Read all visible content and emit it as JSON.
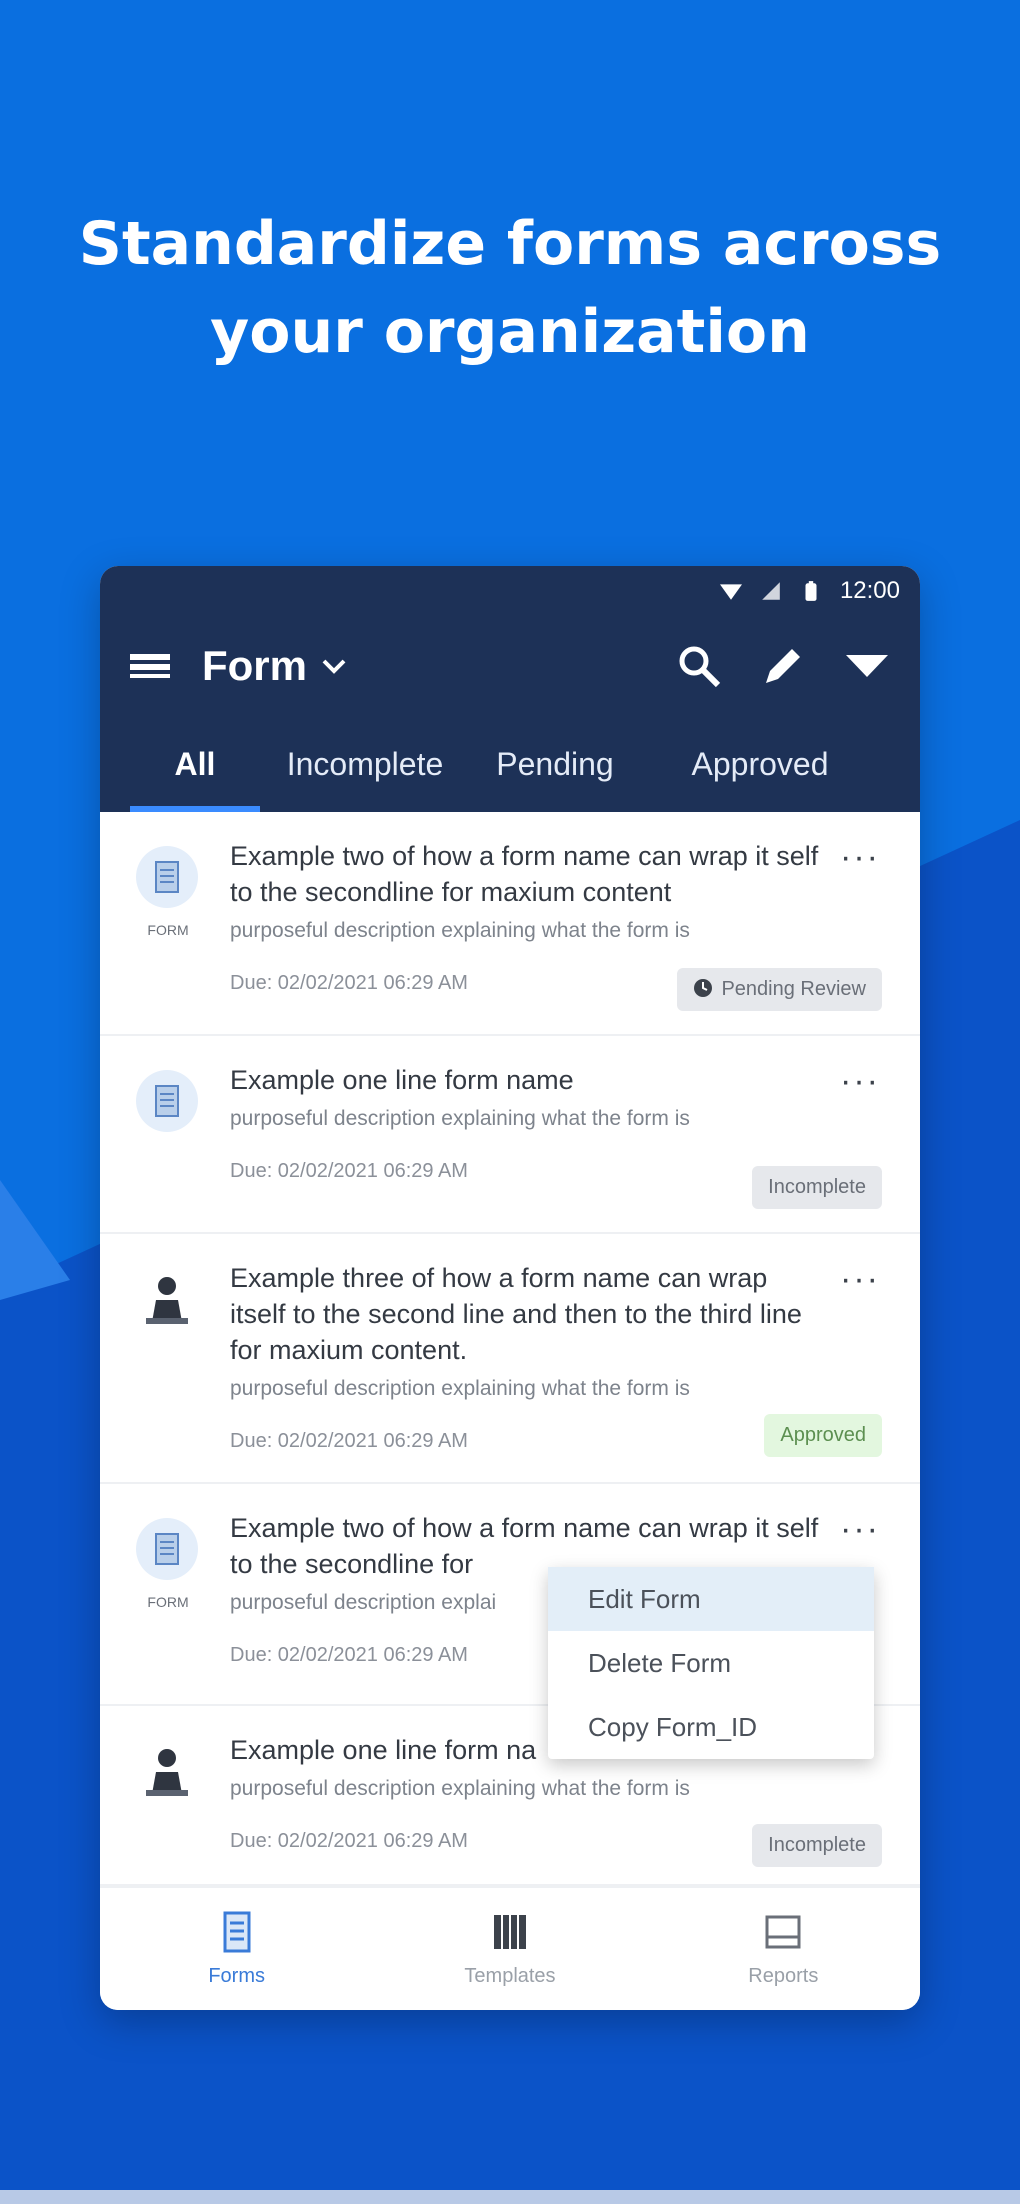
{
  "headline": {
    "line1": "Standardize forms across",
    "line2": "your organization"
  },
  "colors": {
    "background": "#0a6fe0",
    "appbar": "#1d3157",
    "accent": "#3a8bff"
  },
  "statusbar": {
    "time": "12:00"
  },
  "toolbar": {
    "title": "Form",
    "icons": [
      "menu-icon",
      "chevron-down-icon",
      "search-icon",
      "pencil-icon",
      "filter-icon"
    ]
  },
  "tabs": [
    {
      "label": "All",
      "active": true
    },
    {
      "label": "Incomplete",
      "active": false
    },
    {
      "label": "Pending",
      "active": false
    },
    {
      "label": "Approved",
      "active": false
    }
  ],
  "items": [
    {
      "name": "Example two of how a form name can wrap it self to the secondline for maxium content",
      "description": "purposeful description explaining what the form is",
      "due": "Due: 02/02/2021 06:29 AM",
      "badge": "Pending Review",
      "avatar_caption": "FORM"
    },
    {
      "name": "Example one line form name",
      "description": "purposeful description explaining what the form is",
      "due": "Due: 02/02/2021 06:29 AM",
      "badge": "Incomplete"
    },
    {
      "name": "Example three of how a form name can wrap itself to the second line and then to the third line for maxium content.",
      "description": "purposeful description explaining what the form is",
      "due": "Due: 02/02/2021 06:29 AM",
      "badge": "Approved"
    },
    {
      "name": "Example two of how a form name can wrap it self to the secondline for",
      "description": "purposeful description explai",
      "due": "Due: 02/02/2021 06:29 AM",
      "avatar_caption": "FORM"
    },
    {
      "name": "Example one line form na",
      "description": "purposeful description explaining what the form is",
      "due": "Due: 02/02/2021 06:29 AM",
      "badge": "Incomplete"
    }
  ],
  "context_menu": [
    {
      "label": "Edit Form",
      "highlighted": true
    },
    {
      "label": "Delete Form",
      "highlighted": false
    },
    {
      "label": "Copy Form_ID",
      "highlighted": false
    }
  ],
  "bottom_nav": [
    {
      "label": "Forms",
      "active": true
    },
    {
      "label": "Templates",
      "active": false
    },
    {
      "label": "Reports",
      "active": false
    }
  ]
}
